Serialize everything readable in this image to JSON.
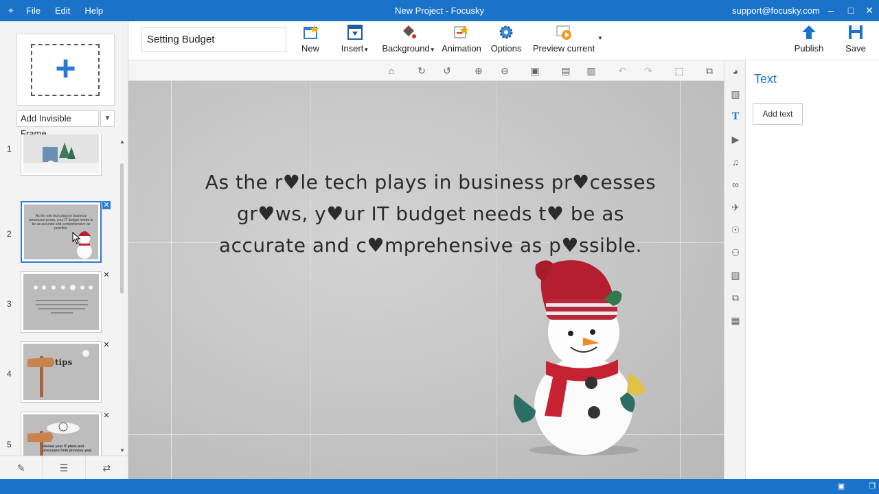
{
  "titlebar": {
    "menu": [
      "File",
      "Edit",
      "Help"
    ],
    "title": "New Project - Focusky",
    "email": "support@focusky.com"
  },
  "left": {
    "add_invisible_frame": "Add Invisible Frame",
    "slides": [
      {
        "num": "1",
        "text": ""
      },
      {
        "num": "2",
        "text": "As the role tech plays in business processes grows, your IT budget needs to be as accurate and comprehensive as possible."
      },
      {
        "num": "3",
        "text": ""
      },
      {
        "num": "4",
        "text": "tips"
      },
      {
        "num": "5",
        "text": "Review your IT plans and processes from previous year."
      }
    ]
  },
  "toolbar": {
    "project_name": "Setting Budget",
    "new": "New",
    "insert": "Insert",
    "background": "Background",
    "animation": "Animation",
    "options": "Options",
    "preview_current": "Preview current",
    "publish": "Publish",
    "save": "Save"
  },
  "canvas": {
    "text": "As the r♥le tech plays in business pr♥cesses gr♥ws, y♥ur IT budget needs t♥ be as accurate and c♥mprehensive as p♥ssible."
  },
  "right": {
    "heading": "Text",
    "add_text": "Add text"
  },
  "colors": {
    "accent": "#1a73c9",
    "selection": "#2b7ad6"
  }
}
